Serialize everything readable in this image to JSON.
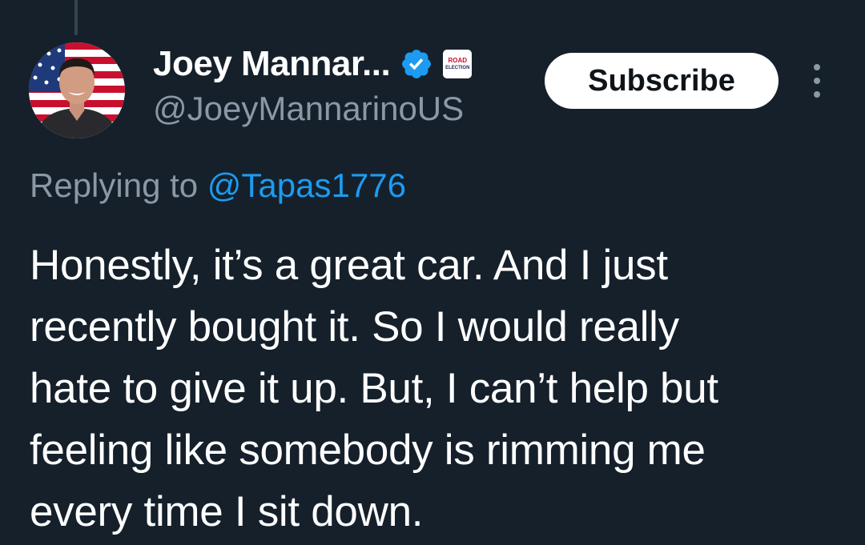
{
  "author": {
    "display_name": "Joey Mannar...",
    "handle": "@JoeyMannarinoUS",
    "verified_icon": "verified-badge-icon",
    "affiliate_badge_line1": "ROAD",
    "affiliate_badge_line2": "ELECTION"
  },
  "actions": {
    "subscribe_label": "Subscribe",
    "more_icon": "more-options-icon"
  },
  "reply": {
    "prefix": "Replying to ",
    "mention": "@Tapas1776"
  },
  "tweet": {
    "lines": [
      "Honestly, it’s a great car. And I just",
      "recently bought it. So I would really",
      "hate to give it up. But, I can’t help but",
      "feeling like somebody is rimming me",
      "every time I sit down."
    ]
  },
  "colors": {
    "background": "#15202b",
    "secondary_text": "#8b98a5",
    "accent": "#1d9bf0",
    "primary_text": "#ffffff"
  }
}
